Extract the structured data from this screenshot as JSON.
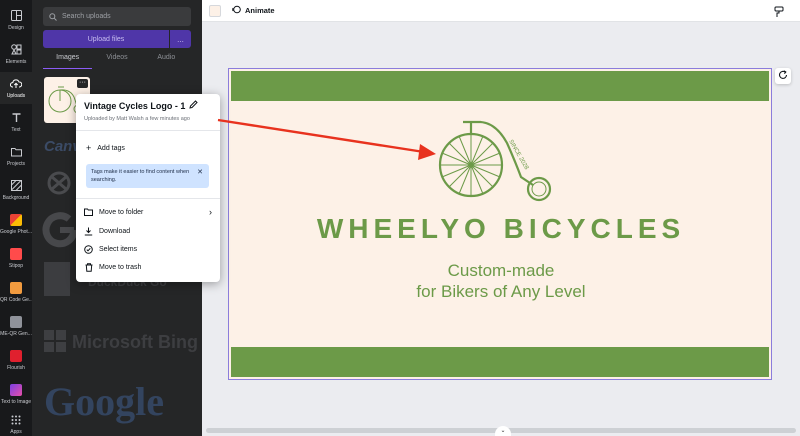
{
  "rail": {
    "items": [
      {
        "label": "Design",
        "icon": "layout-icon"
      },
      {
        "label": "Elements",
        "icon": "shapes-icon"
      },
      {
        "label": "Uploads",
        "icon": "cloud-upload-icon"
      },
      {
        "label": "Text",
        "icon": "text-icon"
      },
      {
        "label": "Projects",
        "icon": "folder-icon"
      },
      {
        "label": "Background",
        "icon": "background-icon"
      },
      {
        "label": "Google Phot...",
        "icon": "google-photos-icon"
      },
      {
        "label": "Stipop",
        "icon": "stipop-icon"
      },
      {
        "label": "QR Code Ge...",
        "icon": "qr-code-icon"
      },
      {
        "label": "ME-QR Gen...",
        "icon": "me-qr-icon"
      },
      {
        "label": "Flourish",
        "icon": "flourish-icon"
      },
      {
        "label": "Text to Image",
        "icon": "text-to-image-icon"
      },
      {
        "label": "Apps",
        "icon": "apps-grid-icon"
      }
    ]
  },
  "panel": {
    "search_placeholder": "Search uploads",
    "upload_button": "Upload files",
    "upload_more": "...",
    "tabs": [
      "Images",
      "Videos",
      "Audio"
    ],
    "bg_logos": {
      "canva": "Canva",
      "duckduckgo": "DuckDuck Go",
      "bing": "Microsoft Bing",
      "google": "Google"
    }
  },
  "popover": {
    "title": "Vintage Cycles Logo - 1",
    "subtitle": "Uploaded by Matt Walsh a few minutes ago",
    "add_tags": "Add tags",
    "tip": "Tags make it easier to find content when searching.",
    "tip_close": "✕",
    "items": [
      "Move to folder",
      "Download",
      "Select items",
      "Move to trash"
    ]
  },
  "topbar": {
    "animate": "Animate"
  },
  "design": {
    "brand": "WHEELYO BICYCLES",
    "tagline_1": "Custom-made",
    "tagline_2": "for Bikers of Any Level",
    "badge": "SINCE 2028"
  },
  "colors": {
    "accent_green": "#6c9a48",
    "canvas_bg": "#fdf1e7",
    "annotation_red": "#e8321e",
    "purple": "#4f36a8"
  }
}
